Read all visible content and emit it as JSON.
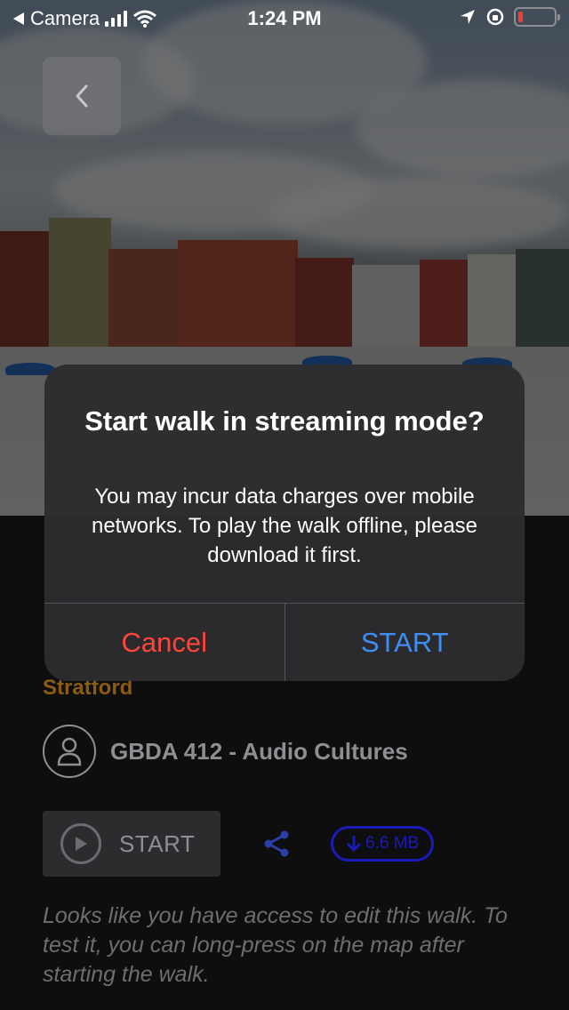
{
  "status_bar": {
    "back_app": "Camera",
    "time": "1:24 PM"
  },
  "walk": {
    "location": "Stratford",
    "creator": "GBDA 412 - Audio Cultures",
    "start_label": "START",
    "download_size": "6.6 MB",
    "edit_notice": "Looks like you have access to edit this walk. To test it, you can long-press on the map after starting the walk."
  },
  "alert": {
    "title": "Start walk in streaming mode?",
    "message": "You may incur data charges over mobile networks. To play the walk offline, please download it first.",
    "cancel_label": "Cancel",
    "confirm_label": "START"
  },
  "colors": {
    "cancel": "#ff453a",
    "confirm": "#3f8ef5",
    "location": "#8a5c12",
    "download": "#1a1ab8"
  },
  "icons": {
    "back": "chevron-left-icon",
    "avatar": "person-icon",
    "play": "play-icon",
    "share": "share-icon",
    "download": "download-arrow-icon"
  }
}
